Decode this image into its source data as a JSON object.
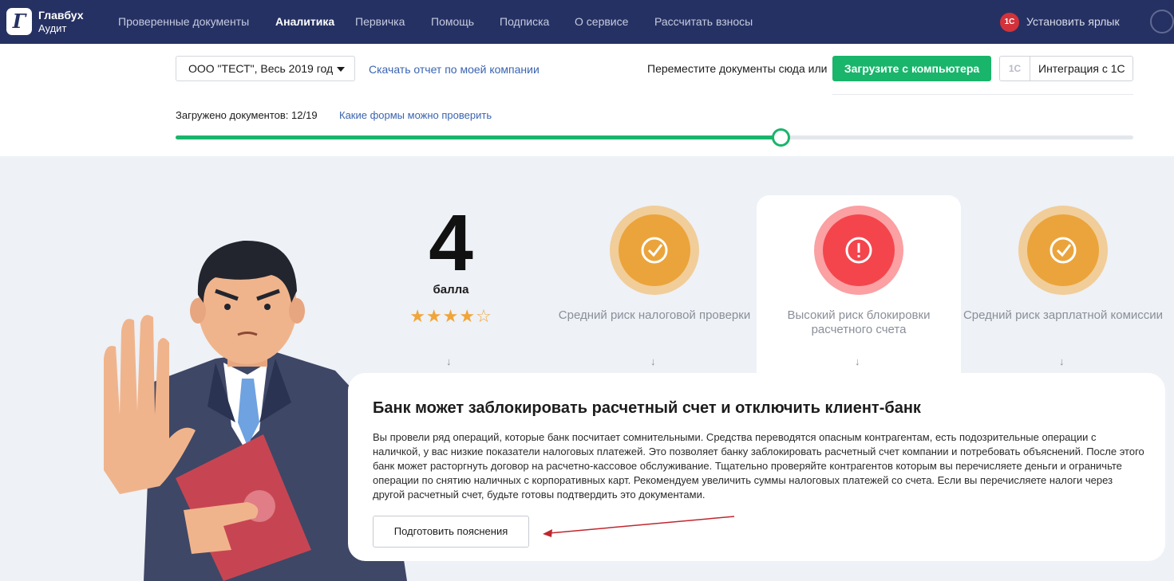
{
  "nav": {
    "brand_line1": "Главбух",
    "brand_line2": "Аудит",
    "logo_letter": "Г",
    "items": [
      {
        "label": "Проверенные документы",
        "active": false
      },
      {
        "label": "Аналитика",
        "active": true
      },
      {
        "label": "Первичка",
        "active": false
      },
      {
        "label": "Помощь",
        "active": false
      },
      {
        "label": "Подписка",
        "active": false
      },
      {
        "label": "О сервисе",
        "active": false
      },
      {
        "label": "Рассчитать взносы",
        "active": false
      }
    ],
    "shortcut_label": "Установить ярлык",
    "shortcut_icon": "shortcut-app-icon",
    "avatar_icon": "user-avatar-icon"
  },
  "filters": {
    "company_select": "ООО \"ТЕСТ\",  Весь 2019 год",
    "download_report": "Скачать отчет по моей компании"
  },
  "upload": {
    "drag_text": "Переместите документы сюда или",
    "upload_button": "Загрузите с компьютера",
    "integration_icon": "1C",
    "integration_button": "Интеграция с 1С"
  },
  "progress": {
    "loaded_label": "Загружено документов: 12/19",
    "loaded": 12,
    "total": 19,
    "forms_link": "Какие формы можно проверить"
  },
  "score": {
    "value": "4",
    "unit": "балла",
    "stars": "★★★★☆",
    "rating": 4,
    "max": 5
  },
  "risks": [
    {
      "label": "Средний риск налоговой проверки",
      "level": "medium",
      "icon": "check-icon",
      "highlighted": false
    },
    {
      "label": "Высокий риск блокировки расчетного счета",
      "level": "high",
      "icon": "exclamation-icon",
      "highlighted": true
    },
    {
      "label": "Средний риск зарплатной комиссии",
      "level": "medium",
      "icon": "check-icon",
      "highlighted": false
    }
  ],
  "colors": {
    "nav_bg": "#263163",
    "accent_green": "#19b56b",
    "medium_risk": "#eba43b",
    "high_risk": "#f4454d",
    "link": "#3a64b1"
  },
  "detail": {
    "title": "Банк может заблокировать расчетный счет и отключить клиент-банк",
    "description": "Вы провели ряд операций, которые банк посчитает сомнительными. Средства переводятся опасным контрагентам, есть подозрительные операции с наличкой, у вас низкие показатели налоговых платежей. Это позволяет банку заблокировать расчетный счет компании и потребовать объяснений. После этого банк может расторгнуть договор на расчетно-кассовое обслуживание. Тщательно проверяйте контрагентов которым вы перечисляете деньги и ограничьте операции по снятию наличных с корпоративных карт. Рекомендуем увеличить суммы налоговых платежей со счета. Если вы перечисляете налоги через другой расчетный счет, будьте готовы подтвердить это документами.",
    "button": "Подготовить пояснения"
  }
}
